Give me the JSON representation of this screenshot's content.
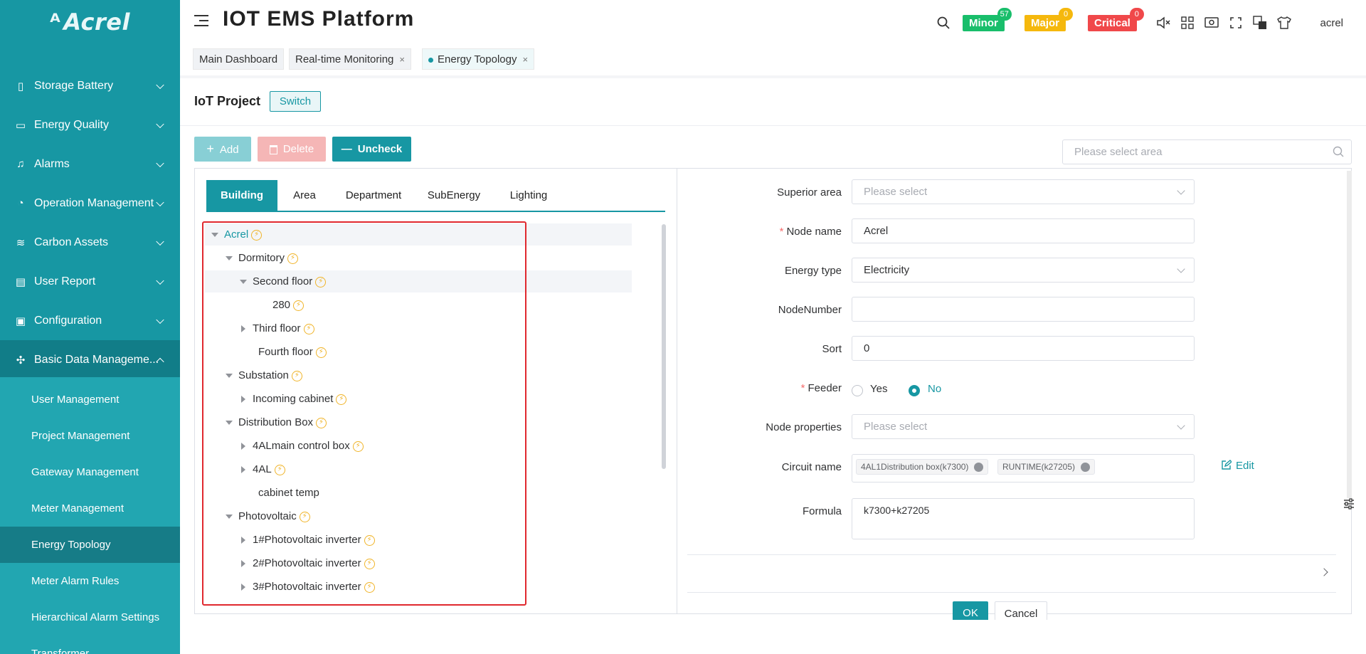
{
  "brand": {
    "logo_text": "Acrel"
  },
  "sidebar": {
    "items": [
      {
        "label": "Storage Battery",
        "icon": "battery-icon"
      },
      {
        "label": "Energy Quality",
        "icon": "monitor-icon"
      },
      {
        "label": "Alarms",
        "icon": "bell-icon"
      },
      {
        "label": "Operation Management",
        "icon": "gauge-icon"
      },
      {
        "label": "Carbon Assets",
        "icon": "database-icon"
      },
      {
        "label": "User Report",
        "icon": "report-icon"
      },
      {
        "label": "Configuration",
        "icon": "config-icon"
      },
      {
        "label": "Basic Data Manageme...",
        "icon": "network-icon"
      }
    ],
    "submenu": [
      "User Management",
      "Project Management",
      "Gateway Management",
      "Meter Management",
      "Energy Topology",
      "Meter Alarm Rules",
      "Hierarchical Alarm Settings",
      "Transformer"
    ]
  },
  "header": {
    "title": "IOT EMS Platform",
    "alarms": [
      {
        "label": "Minor",
        "count": "57",
        "color": "#19be6b",
        "count_color": "#19be6b"
      },
      {
        "label": "Major",
        "count": "0",
        "color": "#f5b80d",
        "count_color": "#f5b80d"
      },
      {
        "label": "Critical",
        "count": "0",
        "color": "#f0484a",
        "count_color": "#f0484a"
      }
    ],
    "user": "acrel"
  },
  "tabs": [
    {
      "label": "Main Dashboard",
      "closable": false
    },
    {
      "label": "Real-time Monitoring",
      "closable": true,
      "close": "×"
    },
    {
      "label": "Energy Topology",
      "closable": true,
      "close": "×",
      "active": true
    }
  ],
  "project": {
    "label": "IoT Project",
    "switch_label": "Switch"
  },
  "toolbar": {
    "add_label": "Add",
    "delete_label": "Delete",
    "uncheck_label": "Uncheck",
    "area_placeholder": "Please select area"
  },
  "tree_tabs": [
    "Building",
    "Area",
    "Department",
    "SubEnergy",
    "Lighting"
  ],
  "tree": [
    {
      "label": "Acrel",
      "depth": 0,
      "arrow": "down",
      "bolt": true
    },
    {
      "label": "Dormitory",
      "depth": 1,
      "arrow": "down",
      "bolt": true
    },
    {
      "label": "Second floor",
      "depth": 2,
      "arrow": "down",
      "bolt": true
    },
    {
      "label": "280",
      "depth": 3,
      "arrow": "none",
      "bolt": true
    },
    {
      "label": "Third floor",
      "depth": 2,
      "arrow": "right",
      "bolt": true
    },
    {
      "label": "Fourth floor",
      "depth": 2,
      "arrow": "none",
      "bolt": true
    },
    {
      "label": "Substation",
      "depth": 1,
      "arrow": "down",
      "bolt": true
    },
    {
      "label": "Incoming cabinet",
      "depth": 2,
      "arrow": "right",
      "bolt": true
    },
    {
      "label": "Distribution Box",
      "depth": 1,
      "arrow": "down",
      "bolt": true
    },
    {
      "label": "4ALmain control box",
      "depth": 2,
      "arrow": "right",
      "bolt": true
    },
    {
      "label": "4AL",
      "depth": 2,
      "arrow": "right",
      "bolt": true
    },
    {
      "label": "cabinet temp",
      "depth": 2,
      "arrow": "none",
      "bolt": false
    },
    {
      "label": "Photovoltaic",
      "depth": 1,
      "arrow": "down",
      "bolt": true
    },
    {
      "label": "1#Photovoltaic inverter",
      "depth": 2,
      "arrow": "right",
      "bolt": true
    },
    {
      "label": "2#Photovoltaic inverter",
      "depth": 2,
      "arrow": "right",
      "bolt": true
    },
    {
      "label": "3#Photovoltaic inverter",
      "depth": 2,
      "arrow": "right",
      "bolt": true
    }
  ],
  "form": {
    "superior_area": {
      "label": "Superior area",
      "placeholder": "Please select"
    },
    "node_name": {
      "label": "Node name",
      "value": "Acrel",
      "required": true
    },
    "energy_type": {
      "label": "Energy type",
      "value": "Electricity"
    },
    "node_number": {
      "label": "NodeNumber",
      "value": ""
    },
    "sort": {
      "label": "Sort",
      "value": "0"
    },
    "feeder": {
      "label": "Feeder",
      "required": true,
      "yes": "Yes",
      "no": "No",
      "selected": "No"
    },
    "node_properties": {
      "label": "Node properties",
      "placeholder": "Please select"
    },
    "circuit_name": {
      "label": "Circuit name",
      "chips": [
        "4AL1Distribution box(k7300)",
        "RUNTIME(k27205)"
      ],
      "edit_label": "Edit"
    },
    "formula": {
      "label": "Formula",
      "value": "k7300+k27205"
    },
    "ok_label": "OK",
    "cancel_label": "Cancel"
  },
  "bolt_glyph": "⚡",
  "required_mark": "*"
}
